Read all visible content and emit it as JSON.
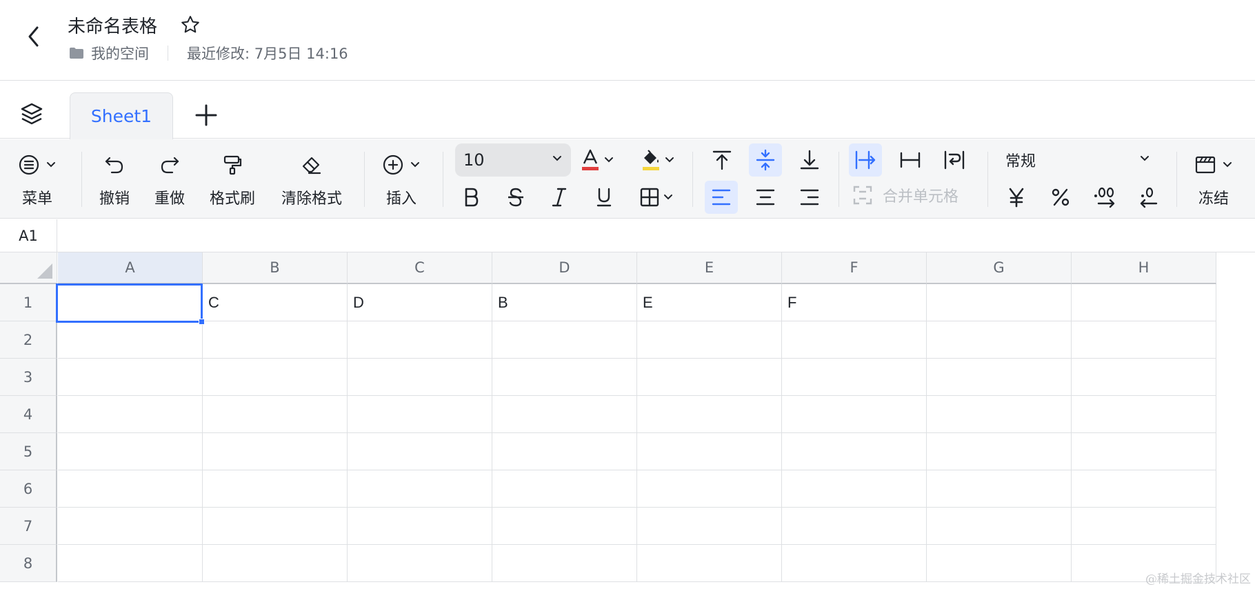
{
  "header": {
    "title": "未命名表格",
    "location": "我的空间",
    "last_modified": "最近修改: 7月5日 14:16"
  },
  "tabs": {
    "sheets": [
      "Sheet1"
    ]
  },
  "toolbar": {
    "menu_label": "菜单",
    "undo_label": "撤销",
    "redo_label": "重做",
    "format_painter_label": "格式刷",
    "clear_format_label": "清除格式",
    "insert_label": "插入",
    "font_size": "10",
    "merge_cells_label": "合并单元格",
    "number_format": "常规",
    "freeze_label": "冻结",
    "text_color": "#e03e3e",
    "fill_color": "#f5d63d",
    "accent_color": "#3370ff"
  },
  "formula_bar": {
    "cell_ref": "A1",
    "value": ""
  },
  "grid": {
    "columns": [
      "A",
      "B",
      "C",
      "D",
      "E",
      "F",
      "G",
      "H"
    ],
    "rows": [
      "1",
      "2",
      "3",
      "4",
      "5",
      "6",
      "7",
      "8"
    ],
    "selected_cell": "A1",
    "cells": {
      "B1": "C",
      "C1": "D",
      "D1": "B",
      "E1": "E",
      "F1": "F"
    }
  },
  "watermark": "@稀土掘金技术社区"
}
